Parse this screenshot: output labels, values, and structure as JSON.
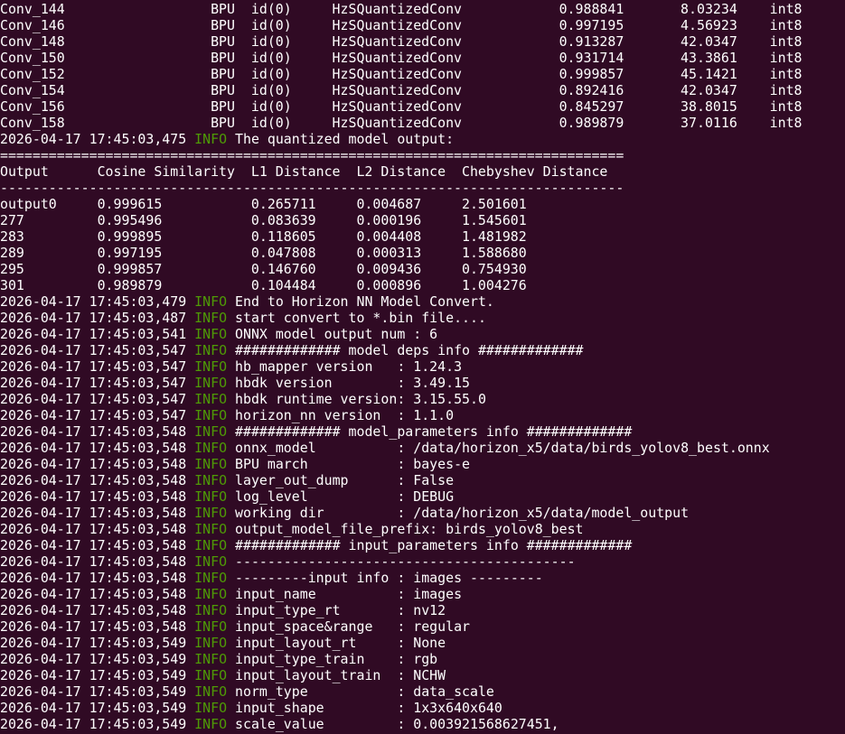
{
  "terminal": {
    "layer_rows": [
      "Conv_144                  BPU  id(0)     HzSQuantizedConv            0.988841       8.03234    int8",
      "Conv_146                  BPU  id(0)     HzSQuantizedConv            0.997195       4.56923    int8",
      "Conv_148                  BPU  id(0)     HzSQuantizedConv            0.913287       42.0347    int8",
      "Conv_150                  BPU  id(0)     HzSQuantizedConv            0.931714       43.3861    int8",
      "Conv_152                  BPU  id(0)     HzSQuantizedConv            0.999857       45.1421    int8",
      "Conv_154                  BPU  id(0)     HzSQuantizedConv            0.892416       42.0347    int8",
      "Conv_156                  BPU  id(0)     HzSQuantizedConv            0.845297       38.8015    int8",
      "Conv_158                  BPU  id(0)     HzSQuantizedConv            0.989879       37.0116    int8"
    ],
    "output_header_log": {
      "ts": "2026-04-17 17:45:03,475",
      "level": "INFO",
      "msg": "The quantized model output:"
    },
    "table_rule_top": "=============================================================================",
    "table_header": "Output      Cosine Similarity  L1 Distance  L2 Distance  Chebyshev Distance",
    "table_rule_mid": "-----------------------------------------------------------------------------",
    "table_rows": [
      "output0     0.999615           0.265711     0.004687     2.501601",
      "277         0.995496           0.083639     0.000196     1.545601",
      "283         0.999895           0.118605     0.004408     1.481982",
      "289         0.997195           0.047808     0.000313     1.588680",
      "295         0.999857           0.146760     0.009436     0.754930",
      "301         0.989879           0.104484     0.000896     1.004276"
    ],
    "logs": [
      {
        "ts": "2026-04-17 17:45:03,479",
        "level": "INFO",
        "msg": "End to Horizon NN Model Convert."
      },
      {
        "ts": "2026-04-17 17:45:03,487",
        "level": "INFO",
        "msg": "start convert to *.bin file...."
      },
      {
        "ts": "2026-04-17 17:45:03,541",
        "level": "INFO",
        "msg": "ONNX model output num : 6"
      },
      {
        "ts": "2026-04-17 17:45:03,547",
        "level": "INFO",
        "msg": "############# model deps info #############"
      },
      {
        "ts": "2026-04-17 17:45:03,547",
        "level": "INFO",
        "msg": "hb_mapper version   : 1.24.3"
      },
      {
        "ts": "2026-04-17 17:45:03,547",
        "level": "INFO",
        "msg": "hbdk version        : 3.49.15"
      },
      {
        "ts": "2026-04-17 17:45:03,547",
        "level": "INFO",
        "msg": "hbdk runtime version: 3.15.55.0"
      },
      {
        "ts": "2026-04-17 17:45:03,547",
        "level": "INFO",
        "msg": "horizon_nn version  : 1.1.0"
      },
      {
        "ts": "2026-04-17 17:45:03,548",
        "level": "INFO",
        "msg": "############# model_parameters info #############"
      },
      {
        "ts": "2026-04-17 17:45:03,548",
        "level": "INFO",
        "msg": "onnx_model          : /data/horizon_x5/data/birds_yolov8_best.onnx"
      },
      {
        "ts": "2026-04-17 17:45:03,548",
        "level": "INFO",
        "msg": "BPU march           : bayes-e"
      },
      {
        "ts": "2026-04-17 17:45:03,548",
        "level": "INFO",
        "msg": "layer_out_dump      : False"
      },
      {
        "ts": "2026-04-17 17:45:03,548",
        "level": "INFO",
        "msg": "log_level           : DEBUG"
      },
      {
        "ts": "2026-04-17 17:45:03,548",
        "level": "INFO",
        "msg": "working dir         : /data/horizon_x5/data/model_output"
      },
      {
        "ts": "2026-04-17 17:45:03,548",
        "level": "INFO",
        "msg": "output_model_file_prefix: birds_yolov8_best"
      },
      {
        "ts": "2026-04-17 17:45:03,548",
        "level": "INFO",
        "msg": "############# input_parameters info #############"
      },
      {
        "ts": "2026-04-17 17:45:03,548",
        "level": "INFO",
        "msg": "------------------------------------------"
      },
      {
        "ts": "2026-04-17 17:45:03,548",
        "level": "INFO",
        "msg": "---------input info : images ---------"
      },
      {
        "ts": "2026-04-17 17:45:03,548",
        "level": "INFO",
        "msg": "input_name          : images"
      },
      {
        "ts": "2026-04-17 17:45:03,548",
        "level": "INFO",
        "msg": "input_type_rt       : nv12"
      },
      {
        "ts": "2026-04-17 17:45:03,548",
        "level": "INFO",
        "msg": "input_space&range   : regular"
      },
      {
        "ts": "2026-04-17 17:45:03,549",
        "level": "INFO",
        "msg": "input_layout_rt     : None"
      },
      {
        "ts": "2026-04-17 17:45:03,549",
        "level": "INFO",
        "msg": "input_type_train    : rgb"
      },
      {
        "ts": "2026-04-17 17:45:03,549",
        "level": "INFO",
        "msg": "input_layout_train  : NCHW"
      },
      {
        "ts": "2026-04-17 17:45:03,549",
        "level": "INFO",
        "msg": "norm_type           : data_scale"
      },
      {
        "ts": "2026-04-17 17:45:03,549",
        "level": "INFO",
        "msg": "input_shape         : 1x3x640x640"
      },
      {
        "ts": "2026-04-17 17:45:03,549",
        "level": "INFO",
        "msg": "scale_value         : 0.003921568627451,"
      }
    ]
  },
  "colors": {
    "background": "#300a24",
    "text": "#ffffff",
    "info_level": "#4e9a06"
  }
}
